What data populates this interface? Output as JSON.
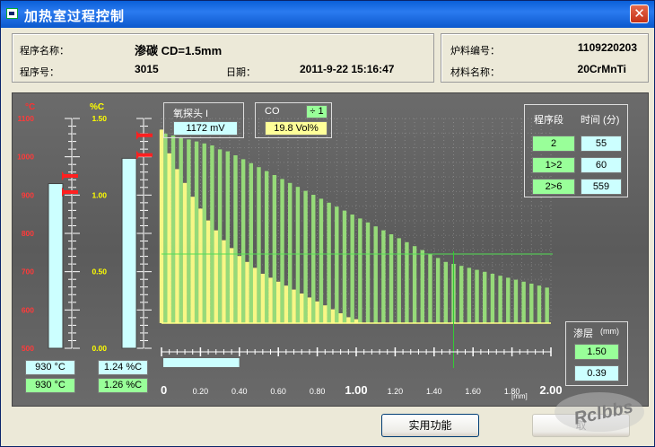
{
  "window": {
    "title": "加热室过程控制",
    "close_label": "✕"
  },
  "info_left": {
    "program_name_label": "程序名称：",
    "program_name_value": "渗碳 CD=1.5mm",
    "program_no_label": "程序号：",
    "program_no_value": "3015",
    "date_label": "日期：",
    "date_value": "2011-9-22 15:16:47"
  },
  "info_right": {
    "furnace_no_label": "炉料编号：",
    "furnace_no_value": "1109220203",
    "material_label": "材料名称：",
    "material_value": "20CrMnTi"
  },
  "gauges": {
    "temp": {
      "unit": "°C",
      "ticks": [
        "1100",
        "1000",
        "900",
        "800",
        "700",
        "600",
        "500"
      ],
      "range": [
        500,
        1100
      ],
      "bar_value": 930,
      "setpoint_value": 950,
      "readout_actual": "930 °C",
      "readout_set": "930 °C"
    },
    "carbon": {
      "unit": "%C",
      "ticks": [
        "1.50",
        "1.00",
        "0.50",
        "0.00"
      ],
      "range": [
        0,
        1.5
      ],
      "bar_value": 1.24,
      "setpoint_value": 1.32,
      "readout_actual": "1.24 %C",
      "readout_set": "1.26 %C"
    }
  },
  "probe": {
    "label": "氧探头 I",
    "value": "1172 mV"
  },
  "co": {
    "label": "CO",
    "factor": "÷ 1",
    "value": "19.8 Vol%"
  },
  "segments": {
    "header_segment": "程序段",
    "header_time": "时间 (分)",
    "rows": [
      {
        "segment": "2",
        "time": "55"
      },
      {
        "segment": "1>2",
        "time": "60"
      },
      {
        "segment": "2>6",
        "time": "559"
      }
    ]
  },
  "layer": {
    "label": "渗层",
    "unit": "(mm)",
    "target": "1.50",
    "current": "0.39"
  },
  "buttons": {
    "utility": "实用功能",
    "cancel": "取"
  },
  "watermark": "Rclbbs",
  "chart_data": {
    "type": "bar",
    "x_axis": {
      "range": [
        0,
        2.0
      ],
      "ticks": [
        "0",
        "0.20",
        "0.40",
        "0.60",
        "0.80",
        "1.00",
        "1.20",
        "1.40",
        "1.60",
        "1.80",
        "2.00"
      ],
      "unit": "[mm]",
      "progress": 0.39
    },
    "crosshair_x": 1.5,
    "target_line_y": 0.35,
    "series": [
      {
        "color": "#99e07a",
        "x": [
          0.02,
          0.06,
          0.1,
          0.14,
          0.18,
          0.22,
          0.26,
          0.3,
          0.34,
          0.38,
          0.42,
          0.46,
          0.5,
          0.54,
          0.58,
          0.62,
          0.66,
          0.7,
          0.74,
          0.78,
          0.82,
          0.86,
          0.9,
          0.94,
          0.98,
          1.02,
          1.06,
          1.1,
          1.14,
          1.18,
          1.22,
          1.26,
          1.3,
          1.34,
          1.38,
          1.42,
          1.46,
          1.5,
          1.54,
          1.58,
          1.62,
          1.66,
          1.7,
          1.74,
          1.78,
          1.82,
          1.86,
          1.9,
          1.94,
          1.98
        ],
        "values": [
          0.96,
          0.95,
          0.94,
          0.93,
          0.92,
          0.91,
          0.9,
          0.88,
          0.87,
          0.85,
          0.83,
          0.81,
          0.79,
          0.77,
          0.75,
          0.73,
          0.71,
          0.69,
          0.67,
          0.65,
          0.63,
          0.61,
          0.59,
          0.57,
          0.55,
          0.53,
          0.51,
          0.49,
          0.47,
          0.45,
          0.43,
          0.41,
          0.39,
          0.37,
          0.35,
          0.33,
          0.31,
          0.3,
          0.29,
          0.28,
          0.27,
          0.26,
          0.25,
          0.24,
          0.23,
          0.22,
          0.21,
          0.2,
          0.19,
          0.18
        ]
      },
      {
        "color": "#ffff88",
        "x": [
          0.0,
          0.04,
          0.08,
          0.12,
          0.16,
          0.2,
          0.24,
          0.28,
          0.32,
          0.36,
          0.4,
          0.44,
          0.48,
          0.52,
          0.56,
          0.6,
          0.64,
          0.68,
          0.72,
          0.76,
          0.8,
          0.84,
          0.88,
          0.92,
          0.96,
          1.0
        ],
        "values": [
          0.98,
          0.86,
          0.78,
          0.71,
          0.64,
          0.58,
          0.52,
          0.47,
          0.42,
          0.38,
          0.34,
          0.31,
          0.28,
          0.25,
          0.23,
          0.21,
          0.19,
          0.17,
          0.15,
          0.13,
          0.11,
          0.09,
          0.07,
          0.05,
          0.03,
          0.02
        ]
      }
    ]
  }
}
